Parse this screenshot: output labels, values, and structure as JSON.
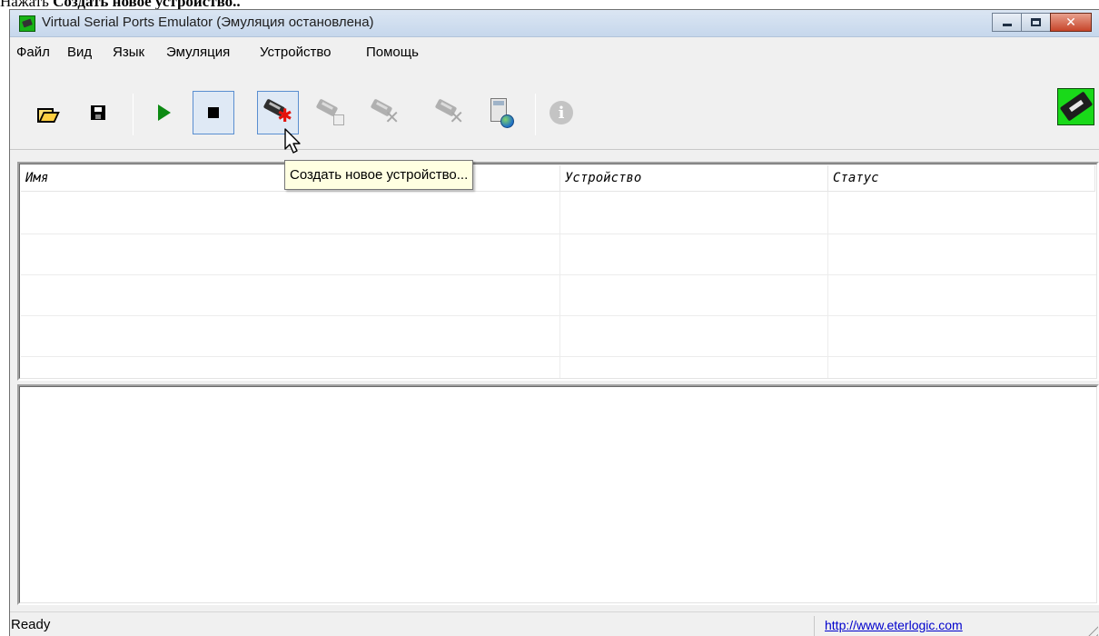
{
  "caption": {
    "prefix": "Нажать ",
    "bold": "Создать новое устройство.."
  },
  "window": {
    "title": "Virtual Serial Ports Emulator (Эмуляция остановлена)",
    "controls": {
      "close_glyph": "✕"
    }
  },
  "menu": [
    "Файл",
    "Вид",
    "Язык",
    "Эмуляция",
    "Устройство",
    "Помощь"
  ],
  "toolbar": {
    "buttons": [
      {
        "name": "open-icon",
        "enabled": true
      },
      {
        "name": "save-icon",
        "enabled": true
      },
      {
        "name": "start-emulation-icon",
        "enabled": true
      },
      {
        "name": "stop-emulation-icon",
        "enabled": true,
        "pressed": true
      },
      {
        "name": "create-device-icon",
        "enabled": true,
        "hovered": true
      },
      {
        "name": "device-properties-icon",
        "enabled": false
      },
      {
        "name": "delete-device-icon",
        "enabled": false
      },
      {
        "name": "delete-all-devices-icon",
        "enabled": false
      },
      {
        "name": "calculator-globe-icon",
        "enabled": true
      },
      {
        "name": "info-icon",
        "enabled": false
      }
    ],
    "logo_icon": "serial-connector-logo-icon"
  },
  "tooltip": "Создать новое устройство...",
  "table": {
    "columns": [
      "Имя",
      "Устройство",
      "Статус"
    ],
    "rows": []
  },
  "status": {
    "text": "Ready",
    "link": "http://www.eterlogic.com"
  },
  "colors": {
    "title_gradient_top": "#dbe6f3",
    "title_gradient_bottom": "#c6d7ec",
    "close_button": "#c7452a",
    "play_green": "#0d8a13",
    "logo_green": "#19d919",
    "tooltip_bg": "#ffffe1",
    "link": "#0000cc"
  }
}
